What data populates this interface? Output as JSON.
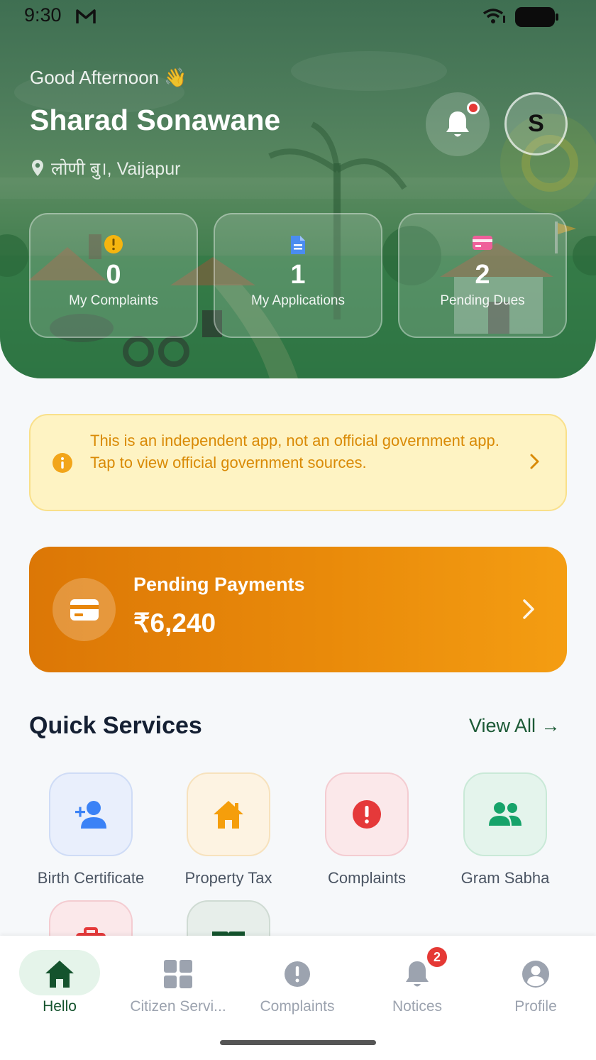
{
  "status_bar": {
    "time": "9:30"
  },
  "header": {
    "greeting": "Good Afternoon 👋",
    "user_name": "Sharad Sonawane",
    "location": "लोणी बु।, Vaijapur",
    "avatar_initial": "S"
  },
  "stats": [
    {
      "value": "0",
      "label": "My Complaints",
      "icon": "warning-icon"
    },
    {
      "value": "1",
      "label": "My Applications",
      "icon": "document-icon"
    },
    {
      "value": "2",
      "label": "Pending Dues",
      "icon": "card-icon"
    }
  ],
  "disclaimer": {
    "text": "This is an independent app, not an official government app. Tap to view official government sources."
  },
  "payments": {
    "title": "Pending Payments",
    "amount": "₹6,240"
  },
  "quick_services": {
    "title": "Quick Services",
    "view_all": "View All →",
    "items": [
      {
        "label": "Birth Certificate",
        "icon": "add-user-icon"
      },
      {
        "label": "Property Tax",
        "icon": "home-icon"
      },
      {
        "label": "Complaints",
        "icon": "alert-icon"
      },
      {
        "label": "Gram Sabha",
        "icon": "group-icon"
      }
    ]
  },
  "bottom_nav": {
    "items": [
      {
        "label": "Hello",
        "icon": "home-icon",
        "active": true
      },
      {
        "label": "Citizen Servi...",
        "icon": "grid-icon"
      },
      {
        "label": "Complaints",
        "icon": "alert-icon"
      },
      {
        "label": "Notices",
        "icon": "bell-icon",
        "badge": "2"
      },
      {
        "label": "Profile",
        "icon": "user-icon"
      }
    ]
  },
  "colors": {
    "primary_green": "#14532d",
    "header_green": "#3f7d4c",
    "payment_orange": "#e98a0a",
    "warning_text": "#d98a06",
    "badge_red": "#e53935"
  }
}
